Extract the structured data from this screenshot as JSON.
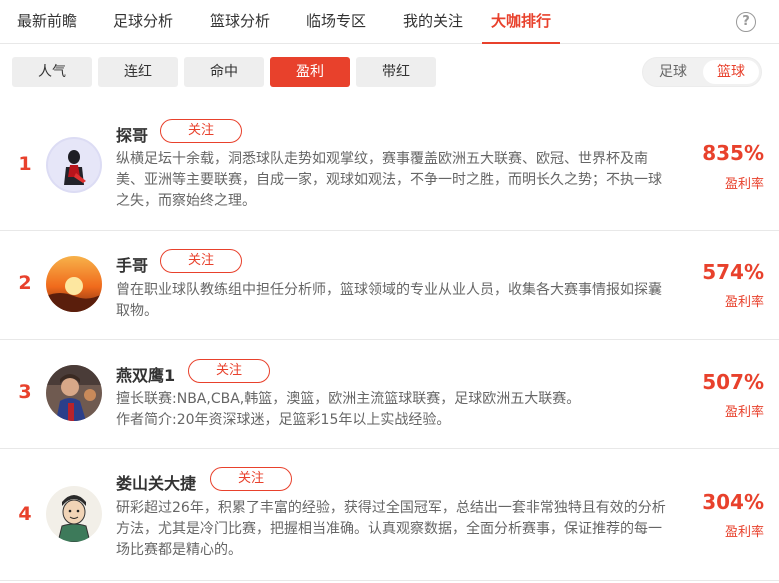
{
  "nav": {
    "tabs": [
      {
        "label": "最新前瞻"
      },
      {
        "label": "足球分析"
      },
      {
        "label": "篮球分析"
      },
      {
        "label": "临场专区"
      },
      {
        "label": "我的关注"
      },
      {
        "label": "大咖排行"
      }
    ],
    "active_tab": "大咖排行",
    "help_glyph": "?"
  },
  "filters": {
    "items": [
      "人气",
      "连红",
      "命中",
      "盈利",
      "带红"
    ],
    "active": "盈利"
  },
  "sport_switch": {
    "options": [
      "足球",
      "篮球"
    ],
    "active": "篮球"
  },
  "follow_label": "关注",
  "rate_label": "盈利率",
  "experts": [
    {
      "rank": "1",
      "name": "探哥",
      "desc": "纵横足坛十余载，洞悉球队走势如观掌纹，赛事覆盖欧洲五大联赛、欧冠、世界杯及南美、亚洲等主要联赛，自成一家，观球如观法，不争一时之胜，而明长久之势；不执一球之失，而察始终之理。",
      "rate": "835%"
    },
    {
      "rank": "2",
      "name": "手哥",
      "desc": "曾在职业球队教练组中担任分析师，篮球领域的专业从业人员，收集各大赛事情报如探囊取物。",
      "rate": "574%"
    },
    {
      "rank": "3",
      "name": "燕双鹰1",
      "desc_line1": "擅长联赛:NBA,CBA,韩篮，澳篮，欧洲主流篮球联赛，足球欧洲五大联赛。",
      "desc_line2": "作者简介:20年资深球迷，足篮彩15年以上实战经验。",
      "rate": "507%"
    },
    {
      "rank": "4",
      "name": "娄山关大捷",
      "desc": "研彩超过26年，积累了丰富的经验，获得过全国冠军，总结出一套非常独特且有效的分析方法，尤其是冷门比赛，把握相当准确。认真观察数据，全面分析赛事，保证推荐的每一场比赛都是精心的。",
      "rate": "304%"
    }
  ],
  "colors": {
    "accent": "#e8412c",
    "text": "#333333",
    "muted": "#666666",
    "divider": "#e8e8e8"
  }
}
